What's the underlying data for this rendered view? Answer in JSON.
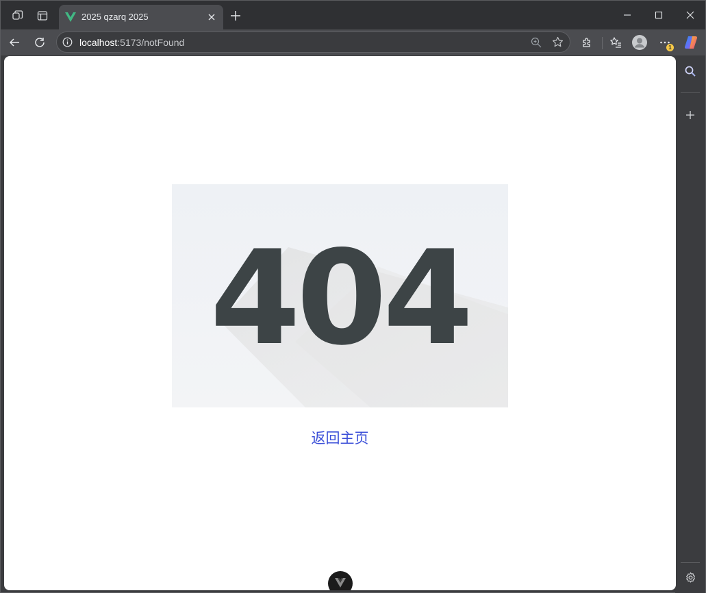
{
  "browser": {
    "tab": {
      "title": "2025 qzarq 2025",
      "favicon": "vue-logo-icon"
    },
    "address_bar": {
      "host": "localhost",
      "path": ":5173/notFound"
    },
    "icons": {
      "workspaces": "workspaces-icon",
      "tab_actions": "tab-actions-icon",
      "back": "back-arrow-icon",
      "reload": "reload-icon",
      "site_info": "info-icon",
      "zoom": "zoom-icon",
      "favorite": "star-icon",
      "extensions": "puzzle-icon",
      "favorites": "favorites-list-icon",
      "profile": "avatar-icon",
      "more": "more-icon",
      "copilot": "copilot-icon",
      "sidebar_search": "search-icon",
      "sidebar_add": "plus-icon",
      "sidebar_settings": "gear-icon"
    },
    "more_badge": "1"
  },
  "page": {
    "hero_text": "404",
    "back_home_link": "返回主页"
  },
  "colors": {
    "link": "#3b4fd8",
    "hero_digits": "#3d4446",
    "vue_green": "#42b883"
  }
}
